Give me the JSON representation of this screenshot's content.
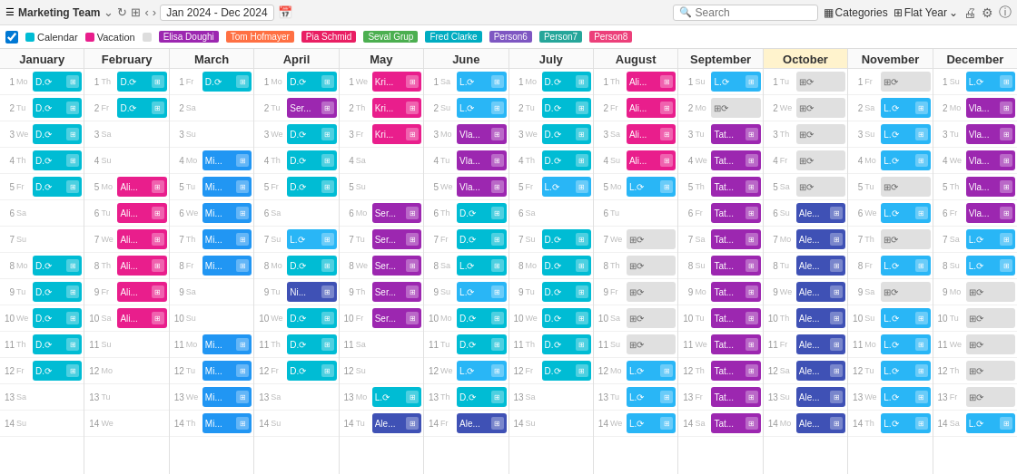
{
  "toolbar": {
    "team": "Marketing Team",
    "date_range": "Jan 2024 - Dec 2024",
    "search_placeholder": "Search",
    "categories_label": "Categories",
    "flat_year_label": "Flat Year"
  },
  "filters": {
    "calendar_label": "Calendar",
    "calendar_color": "#00bcd4",
    "vacation_label": "Vacation",
    "vacation_color": "#e91e8c",
    "people": [
      {
        "name": "Elisa Doughi",
        "color": "#9c27b0"
      },
      {
        "name": "Tom Hofmayer",
        "color": "#ff7043"
      },
      {
        "name": "Pia Schmid",
        "color": "#e91e63"
      },
      {
        "name": "Seval Grup",
        "color": "#4caf50"
      },
      {
        "name": "Fred Clarke",
        "color": "#00acc1"
      },
      {
        "name": "Person6",
        "color": "#7e57c2"
      },
      {
        "name": "Person7",
        "color": "#26a69a"
      },
      {
        "name": "Person8",
        "color": "#ec407a"
      }
    ]
  },
  "months": [
    {
      "name": "January",
      "highlight": false
    },
    {
      "name": "February",
      "highlight": false
    },
    {
      "name": "March",
      "highlight": false
    },
    {
      "name": "April",
      "highlight": false
    },
    {
      "name": "May",
      "highlight": false
    },
    {
      "name": "June",
      "highlight": false
    },
    {
      "name": "July",
      "highlight": false
    },
    {
      "name": "August",
      "highlight": false
    },
    {
      "name": "September",
      "highlight": false
    },
    {
      "name": "October",
      "highlight": true
    },
    {
      "name": "November",
      "highlight": false
    },
    {
      "name": "December",
      "highlight": false
    }
  ],
  "days_of_week": [
    "Mo",
    "Tu",
    "We",
    "Th",
    "Fr",
    "Sa",
    "Su"
  ]
}
